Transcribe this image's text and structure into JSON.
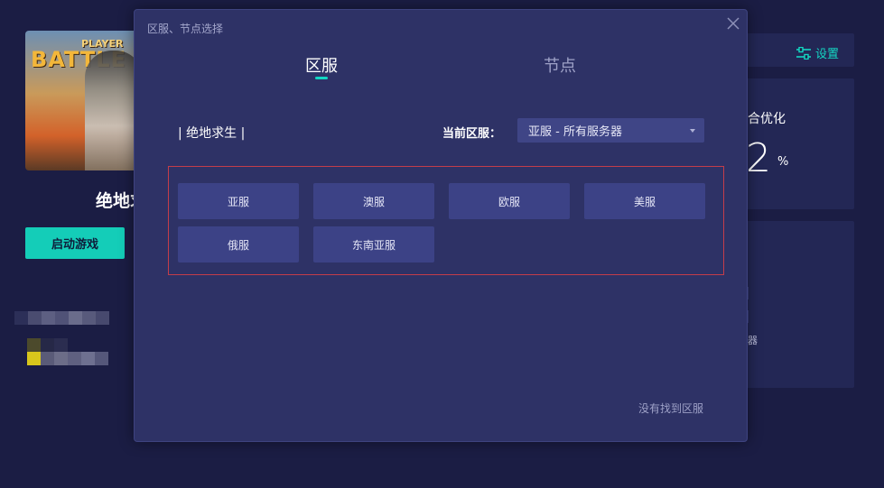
{
  "background": {
    "cover_small_text": "PLAYER",
    "cover_big_text": "BATTLE",
    "game_title": "绝地求生",
    "launch_button": "启动游戏",
    "settings_label": "设置",
    "optimize_label": "合优化",
    "optimize_value": "2",
    "optimize_unit": "%",
    "lower_text": "器"
  },
  "modal": {
    "title": "区服、节点选择",
    "tabs": [
      {
        "label": "区服",
        "active": true
      },
      {
        "label": "节点",
        "active": false
      }
    ],
    "game_name": "| 绝地求生 |",
    "current_region_label": "当前区服：",
    "current_region_value": "亚服 - 所有服务器",
    "servers": [
      "亚服",
      "澳服",
      "欧服",
      "美服",
      "俄服",
      "东南亚服"
    ],
    "help_link": "没有找到区服"
  },
  "colors": {
    "accent": "#14d7c3",
    "modal_bg": "#2e3266",
    "server_button_bg": "#3c4286",
    "box_border": "#c33d4a"
  },
  "icons": [
    "close-icon",
    "settings-sliders-icon",
    "dropdown-caret-icon"
  ]
}
